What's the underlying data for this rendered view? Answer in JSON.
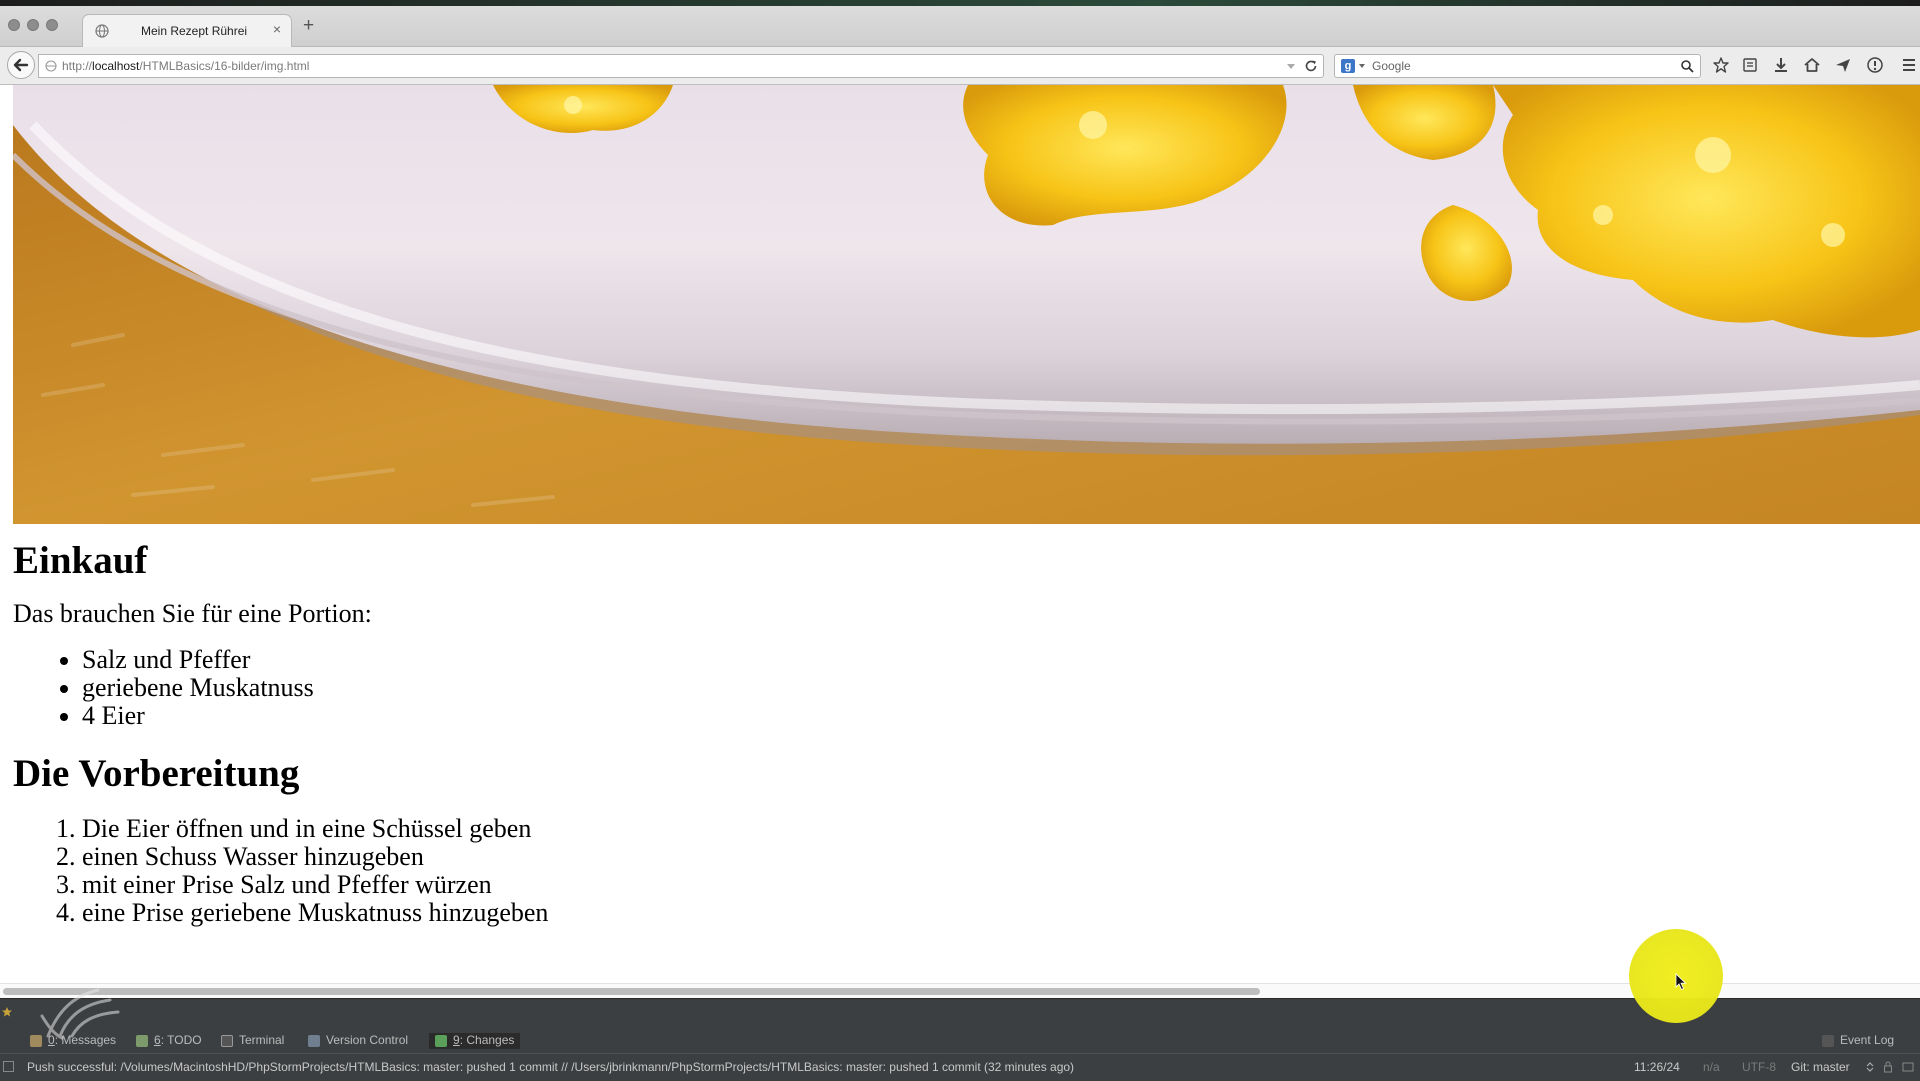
{
  "browser": {
    "tab_title": "Mein Rezept Rührei",
    "url_prefix": "http://",
    "url_host": "localhost",
    "url_path": "/HTMLBasics/16-bilder/img.html",
    "search_engine_letter": "g",
    "search_placeholder": "Google"
  },
  "page": {
    "heading_shopping": "Einkauf",
    "intro": "Das brauchen Sie für eine Portion:",
    "ingredients": [
      "Salz und Pfeffer",
      "geriebene Muskatnuss",
      "4 Eier"
    ],
    "heading_prep": "Die Vorbereitung",
    "steps": [
      "Die Eier öffnen und in eine Schüssel geben",
      "einen Schuss Wasser hinzugeben",
      "mit einer Prise Salz und Pfeffer würzen",
      "eine Prise geriebene Muskatnuss hinzugeben"
    ]
  },
  "ide": {
    "tool_tabs": {
      "messages_num": "0",
      "messages_label": ": Messages",
      "todo_num": "6",
      "todo_label": ": TODO",
      "terminal": "Terminal",
      "vcs": "Version Control",
      "changes_num": "9",
      "changes_label": ": Changes"
    },
    "event_log": "Event Log",
    "status_message": "Push successful: /Volumes/MacintoshHD/PhpStormProjects/HTMLBasics: master: pushed 1 commit // /Users/jbrinkmann/PhpStormProjects/HTMLBasics: master: pushed 1 commit (32 minutes ago)",
    "cursor_pos": "11:26/24",
    "line_sep": "n/a",
    "encoding": "UTF-8",
    "git_branch": "Git: master"
  },
  "colors": {
    "ide_bg": "#3c3f41",
    "cursor_highlight": "#e8e61a",
    "egg_yellow": "#f5c215",
    "placemat_orange": "#c98a24"
  },
  "icons": [
    "back-arrow-icon",
    "globe-icon",
    "reload-icon",
    "search-icon",
    "bookmark-star-icon",
    "reading-list-icon",
    "download-icon",
    "home-icon",
    "send-icon",
    "info-icon",
    "menu-icon"
  ]
}
